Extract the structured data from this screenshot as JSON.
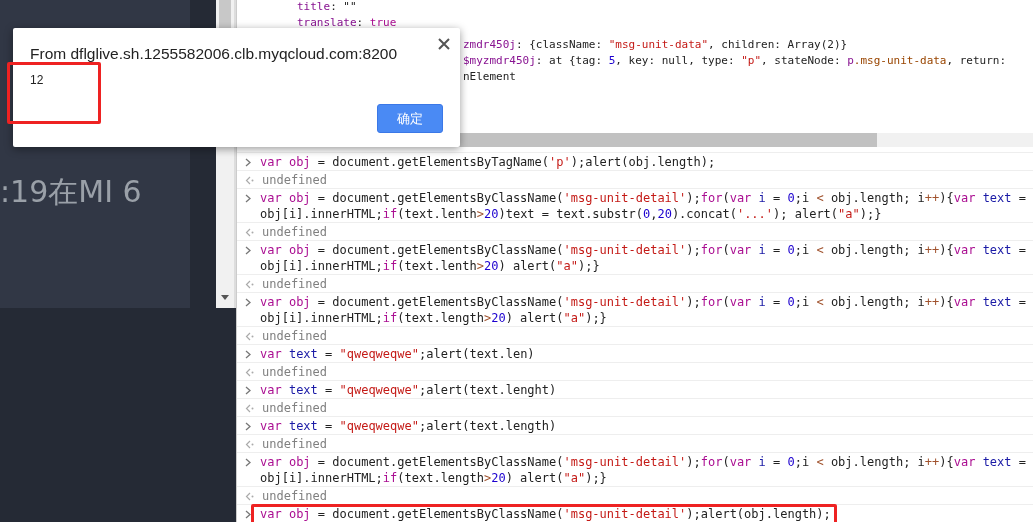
{
  "app_panel": {
    "card_text": ":19在MI 6"
  },
  "devtools": {
    "object_lines": [
      {
        "tokens": [
          {
            "kind": "prop",
            "text": "title"
          },
          {
            "kind": "text",
            "text": ": \"\""
          }
        ]
      },
      {
        "tokens": [
          {
            "kind": "prop",
            "text": "translate"
          },
          {
            "kind": "text",
            "text": ": "
          },
          {
            "kind": "keyword",
            "text": "true"
          }
        ]
      },
      {
        "partial": true,
        "tokens": [
          {
            "kind": "prop",
            "text": "zmdr450j"
          },
          {
            "kind": "text",
            "text": ": {className: "
          },
          {
            "kind": "string",
            "text": "\"msg-unit-data\""
          },
          {
            "kind": "text",
            "text": ", children: Array(2)}"
          }
        ]
      },
      {
        "partial": true,
        "tokens": [
          {
            "kind": "prop",
            "text": "$myzmdr450j"
          },
          {
            "kind": "text",
            "text": ": at {tag: "
          },
          {
            "kind": "number",
            "text": "5"
          },
          {
            "kind": "text",
            "text": ", key: null, type: "
          },
          {
            "kind": "string",
            "text": "\"p\""
          },
          {
            "kind": "text",
            "text": ", stateNode: "
          },
          {
            "kind": "prop",
            "text": "p"
          },
          {
            "kind": "class",
            "text": ".msg-unit-data"
          },
          {
            "kind": "text",
            "text": ", return:"
          }
        ]
      },
      {
        "partial": true,
        "tokens": [
          {
            "kind": "text",
            "text": "nElement"
          }
        ]
      }
    ],
    "console": [
      {
        "kind": "input",
        "highlighted": false,
        "lines": [
          [
            {
              "kind": "keyword",
              "text": "var "
            },
            {
              "kind": "definition",
              "text": "obj"
            },
            {
              "kind": "text",
              "text": " = document.getElementsByTagName("
            },
            {
              "kind": "string",
              "text": "'p'"
            },
            {
              "kind": "text",
              "text": ");alert(obj.length);"
            }
          ]
        ]
      },
      {
        "kind": "output",
        "highlighted": false,
        "lines": [
          [
            {
              "kind": "muted",
              "text": "undefined"
            }
          ]
        ]
      },
      {
        "kind": "input",
        "highlighted": false,
        "lines": [
          [
            {
              "kind": "keyword",
              "text": "var "
            },
            {
              "kind": "definition",
              "text": "obj"
            },
            {
              "kind": "text",
              "text": " = document.getElementsByClassName("
            },
            {
              "kind": "string",
              "text": "'msg-unit-detail'"
            },
            {
              "kind": "text",
              "text": ");"
            },
            {
              "kind": "keyword",
              "text": "for"
            },
            {
              "kind": "text",
              "text": "("
            },
            {
              "kind": "keyword",
              "text": "var "
            },
            {
              "kind": "variable",
              "text": "i"
            },
            {
              "kind": "text",
              "text": " = "
            },
            {
              "kind": "number",
              "text": "0"
            },
            {
              "kind": "text",
              "text": ";i "
            },
            {
              "kind": "operator",
              "text": "<"
            },
            {
              "kind": "text",
              "text": " obj.length; i"
            },
            {
              "kind": "operator",
              "text": "++"
            },
            {
              "kind": "text",
              "text": "){"
            },
            {
              "kind": "keyword",
              "text": "var "
            },
            {
              "kind": "variable",
              "text": "text"
            },
            {
              "kind": "text",
              "text": " ="
            }
          ],
          [
            {
              "kind": "text",
              "text": "obj[i].innerHTML;"
            },
            {
              "kind": "keyword",
              "text": "if"
            },
            {
              "kind": "text",
              "text": "(text.lenth"
            },
            {
              "kind": "operator",
              "text": ">"
            },
            {
              "kind": "number",
              "text": "20"
            },
            {
              "kind": "text",
              "text": ")text = text.substr("
            },
            {
              "kind": "number",
              "text": "0"
            },
            {
              "kind": "text",
              "text": ","
            },
            {
              "kind": "number",
              "text": "20"
            },
            {
              "kind": "text",
              "text": ").concat("
            },
            {
              "kind": "string",
              "text": "'...'"
            },
            {
              "kind": "text",
              "text": "); alert("
            },
            {
              "kind": "string",
              "text": "\"a\""
            },
            {
              "kind": "text",
              "text": ");}"
            }
          ]
        ]
      },
      {
        "kind": "output",
        "highlighted": false,
        "lines": [
          [
            {
              "kind": "muted",
              "text": "undefined"
            }
          ]
        ]
      },
      {
        "kind": "input",
        "highlighted": false,
        "lines": [
          [
            {
              "kind": "keyword",
              "text": "var "
            },
            {
              "kind": "definition",
              "text": "obj"
            },
            {
              "kind": "text",
              "text": " = document.getElementsByClassName("
            },
            {
              "kind": "string",
              "text": "'msg-unit-detail'"
            },
            {
              "kind": "text",
              "text": ");"
            },
            {
              "kind": "keyword",
              "text": "for"
            },
            {
              "kind": "text",
              "text": "("
            },
            {
              "kind": "keyword",
              "text": "var "
            },
            {
              "kind": "variable",
              "text": "i"
            },
            {
              "kind": "text",
              "text": " = "
            },
            {
              "kind": "number",
              "text": "0"
            },
            {
              "kind": "text",
              "text": ";i "
            },
            {
              "kind": "operator",
              "text": "<"
            },
            {
              "kind": "text",
              "text": " obj.length; i"
            },
            {
              "kind": "operator",
              "text": "++"
            },
            {
              "kind": "text",
              "text": "){"
            },
            {
              "kind": "keyword",
              "text": "var "
            },
            {
              "kind": "variable",
              "text": "text"
            },
            {
              "kind": "text",
              "text": " ="
            }
          ],
          [
            {
              "kind": "text",
              "text": "obj[i].innerHTML;"
            },
            {
              "kind": "keyword",
              "text": "if"
            },
            {
              "kind": "text",
              "text": "(text.lenth"
            },
            {
              "kind": "operator",
              "text": ">"
            },
            {
              "kind": "number",
              "text": "20"
            },
            {
              "kind": "text",
              "text": ") alert("
            },
            {
              "kind": "string",
              "text": "\"a\""
            },
            {
              "kind": "text",
              "text": ");}"
            }
          ]
        ]
      },
      {
        "kind": "output",
        "highlighted": false,
        "lines": [
          [
            {
              "kind": "muted",
              "text": "undefined"
            }
          ]
        ]
      },
      {
        "kind": "input",
        "highlighted": false,
        "lines": [
          [
            {
              "kind": "keyword",
              "text": "var "
            },
            {
              "kind": "definition",
              "text": "obj"
            },
            {
              "kind": "text",
              "text": " = document.getElementsByClassName("
            },
            {
              "kind": "string",
              "text": "'msg-unit-detail'"
            },
            {
              "kind": "text",
              "text": ");"
            },
            {
              "kind": "keyword",
              "text": "for"
            },
            {
              "kind": "text",
              "text": "("
            },
            {
              "kind": "keyword",
              "text": "var "
            },
            {
              "kind": "variable",
              "text": "i"
            },
            {
              "kind": "text",
              "text": " = "
            },
            {
              "kind": "number",
              "text": "0"
            },
            {
              "kind": "text",
              "text": ";i "
            },
            {
              "kind": "operator",
              "text": "<"
            },
            {
              "kind": "text",
              "text": " obj.length; i"
            },
            {
              "kind": "operator",
              "text": "++"
            },
            {
              "kind": "text",
              "text": "){"
            },
            {
              "kind": "keyword",
              "text": "var "
            },
            {
              "kind": "variable",
              "text": "text"
            },
            {
              "kind": "text",
              "text": " ="
            }
          ],
          [
            {
              "kind": "text",
              "text": "obj[i].innerHTML;"
            },
            {
              "kind": "keyword",
              "text": "if"
            },
            {
              "kind": "text",
              "text": "(text.length"
            },
            {
              "kind": "operator",
              "text": ">"
            },
            {
              "kind": "number",
              "text": "20"
            },
            {
              "kind": "text",
              "text": ") alert("
            },
            {
              "kind": "string",
              "text": "\"a\""
            },
            {
              "kind": "text",
              "text": ");}"
            }
          ]
        ]
      },
      {
        "kind": "output",
        "highlighted": false,
        "lines": [
          [
            {
              "kind": "muted",
              "text": "undefined"
            }
          ]
        ]
      },
      {
        "kind": "input",
        "highlighted": false,
        "lines": [
          [
            {
              "kind": "keyword",
              "text": "var "
            },
            {
              "kind": "variable",
              "text": "text"
            },
            {
              "kind": "text",
              "text": " = "
            },
            {
              "kind": "string",
              "text": "\"qweqweqwe\""
            },
            {
              "kind": "text",
              "text": ";alert(text.len)"
            }
          ]
        ]
      },
      {
        "kind": "output",
        "highlighted": false,
        "lines": [
          [
            {
              "kind": "muted",
              "text": "undefined"
            }
          ]
        ]
      },
      {
        "kind": "input",
        "highlighted": false,
        "lines": [
          [
            {
              "kind": "keyword",
              "text": "var "
            },
            {
              "kind": "variable",
              "text": "text"
            },
            {
              "kind": "text",
              "text": " = "
            },
            {
              "kind": "string",
              "text": "\"qweqweqwe\""
            },
            {
              "kind": "text",
              "text": ";alert(text.lenght)"
            }
          ]
        ]
      },
      {
        "kind": "output",
        "highlighted": false,
        "lines": [
          [
            {
              "kind": "muted",
              "text": "undefined"
            }
          ]
        ]
      },
      {
        "kind": "input",
        "highlighted": false,
        "lines": [
          [
            {
              "kind": "keyword",
              "text": "var "
            },
            {
              "kind": "variable",
              "text": "text"
            },
            {
              "kind": "text",
              "text": " = "
            },
            {
              "kind": "string",
              "text": "\"qweqweqwe\""
            },
            {
              "kind": "text",
              "text": ";alert(text.length)"
            }
          ]
        ]
      },
      {
        "kind": "output",
        "highlighted": false,
        "lines": [
          [
            {
              "kind": "muted",
              "text": "undefined"
            }
          ]
        ]
      },
      {
        "kind": "input",
        "highlighted": false,
        "lines": [
          [
            {
              "kind": "keyword",
              "text": "var "
            },
            {
              "kind": "definition",
              "text": "obj"
            },
            {
              "kind": "text",
              "text": " = document.getElementsByClassName("
            },
            {
              "kind": "string",
              "text": "'msg-unit-detail'"
            },
            {
              "kind": "text",
              "text": ");"
            },
            {
              "kind": "keyword",
              "text": "for"
            },
            {
              "kind": "text",
              "text": "("
            },
            {
              "kind": "keyword",
              "text": "var "
            },
            {
              "kind": "variable",
              "text": "i"
            },
            {
              "kind": "text",
              "text": " = "
            },
            {
              "kind": "number",
              "text": "0"
            },
            {
              "kind": "text",
              "text": ";i "
            },
            {
              "kind": "operator",
              "text": "<"
            },
            {
              "kind": "text",
              "text": " obj.length; i"
            },
            {
              "kind": "operator",
              "text": "++"
            },
            {
              "kind": "text",
              "text": "){"
            },
            {
              "kind": "keyword",
              "text": "var "
            },
            {
              "kind": "variable",
              "text": "text"
            },
            {
              "kind": "text",
              "text": " ="
            }
          ],
          [
            {
              "kind": "text",
              "text": "obj[i].innerHTML;"
            },
            {
              "kind": "keyword",
              "text": "if"
            },
            {
              "kind": "text",
              "text": "(text.length"
            },
            {
              "kind": "operator",
              "text": ">"
            },
            {
              "kind": "number",
              "text": "20"
            },
            {
              "kind": "text",
              "text": ") alert("
            },
            {
              "kind": "string",
              "text": "\"a\""
            },
            {
              "kind": "text",
              "text": ");}"
            }
          ]
        ]
      },
      {
        "kind": "output",
        "highlighted": false,
        "lines": [
          [
            {
              "kind": "muted",
              "text": "undefined"
            }
          ]
        ]
      },
      {
        "kind": "input",
        "highlighted": true,
        "lines": [
          [
            {
              "kind": "keyword",
              "text": "var "
            },
            {
              "kind": "definition",
              "text": "obj"
            },
            {
              "kind": "text",
              "text": " = document.getElementsByClassName("
            },
            {
              "kind": "string",
              "text": "'msg-unit-detail'"
            },
            {
              "kind": "text",
              "text": ");alert(obj.length);"
            }
          ]
        ]
      }
    ]
  },
  "alert": {
    "title": "From dflglive.sh.1255582006.clb.myqcloud.com:8200",
    "message": "12",
    "message_highlighted": true,
    "button": "确定"
  }
}
